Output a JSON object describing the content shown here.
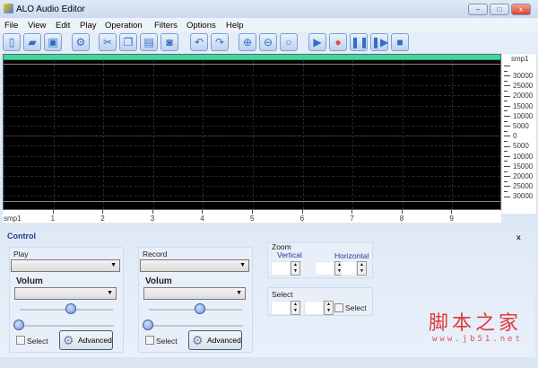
{
  "window": {
    "title": "ALO Audio Editor",
    "min": "–",
    "max": "□",
    "close": "x"
  },
  "menu": [
    "File",
    "View",
    "Edit",
    "Play",
    "Operation",
    "Filters",
    "Options",
    "Help"
  ],
  "toolbar": [
    {
      "icon": "new-icon",
      "g": "▯"
    },
    {
      "icon": "open-icon",
      "g": "▰"
    },
    {
      "icon": "save-icon",
      "g": "▣"
    },
    {
      "icon": "settings-icon",
      "g": "⚙"
    },
    {
      "icon": "cut-icon",
      "g": "✂"
    },
    {
      "icon": "copy-icon",
      "g": "❐"
    },
    {
      "icon": "paste-icon",
      "g": "▤"
    },
    {
      "icon": "mix-paste-icon",
      "g": "◙"
    },
    {
      "icon": "undo-icon",
      "g": "↶"
    },
    {
      "icon": "redo-icon",
      "g": "↷"
    },
    {
      "icon": "zoom-in-icon",
      "g": "⊕"
    },
    {
      "icon": "zoom-out-icon",
      "g": "⊖"
    },
    {
      "icon": "zoom-fit-icon",
      "g": "○"
    },
    {
      "icon": "play-icon",
      "g": "▶"
    },
    {
      "icon": "record-icon",
      "g": "●"
    },
    {
      "icon": "pause-icon",
      "g": "❚❚"
    },
    {
      "icon": "play-next-icon",
      "g": "❚▶"
    },
    {
      "icon": "stop-icon",
      "g": "■"
    }
  ],
  "wave": {
    "unit_label": "smp1",
    "y_labels": [
      "30000",
      "25000",
      "20000",
      "15000",
      "10000",
      "5000",
      "0",
      "5000",
      "10000",
      "15000",
      "20000",
      "25000",
      "30000"
    ],
    "x_labels": [
      "smp1",
      "1",
      "2",
      "3",
      "4",
      "5",
      "6",
      "7",
      "8",
      "9"
    ]
  },
  "control": {
    "title": "Control",
    "close": "x",
    "play": {
      "label": "Play",
      "volume": "Volum",
      "select": "Select",
      "advanced": "Advanced",
      "volume_slider": 0.55,
      "pos_slider": 0.0
    },
    "record": {
      "label": "Record",
      "volume": "Volum",
      "select": "Select",
      "advanced": "Advanced",
      "volume_slider": 0.55,
      "pos_slider": 0.0
    },
    "zoom": {
      "label": "Zoom",
      "vertical": "Vertical",
      "horizontal": "Horizontal"
    },
    "selectgrp": {
      "label": "Select",
      "select": "Select"
    }
  },
  "watermark": {
    "text": "脚本之家",
    "url": "www.jb51.net"
  }
}
